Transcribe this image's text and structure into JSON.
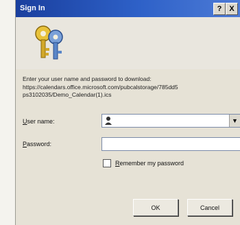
{
  "window": {
    "title": "Sign In",
    "help_glyph": "?",
    "close_glyph": "X"
  },
  "icons": {
    "header": "keys-icon",
    "user": "user-icon",
    "dropdown": "chevron-down-icon"
  },
  "prompt": {
    "text": "Enter your user name and password to download:\nhttps://calendars.office.microsoft.com/pubcalstorage/785dd5\nps3102035/Demo_Calendar(1).ics"
  },
  "fields": {
    "username_label_accel": "U",
    "username_label_rest": "ser name:",
    "username_value": "",
    "password_label_accel": "P",
    "password_label_rest": "assword:",
    "password_value": ""
  },
  "remember": {
    "label_accel": "R",
    "label_rest": "emember my password",
    "checked": false
  },
  "buttons": {
    "ok": "OK",
    "cancel": "Cancel"
  },
  "colors": {
    "titlebar": "#2e61c8",
    "dialog_bg": "#e6e2d6"
  }
}
